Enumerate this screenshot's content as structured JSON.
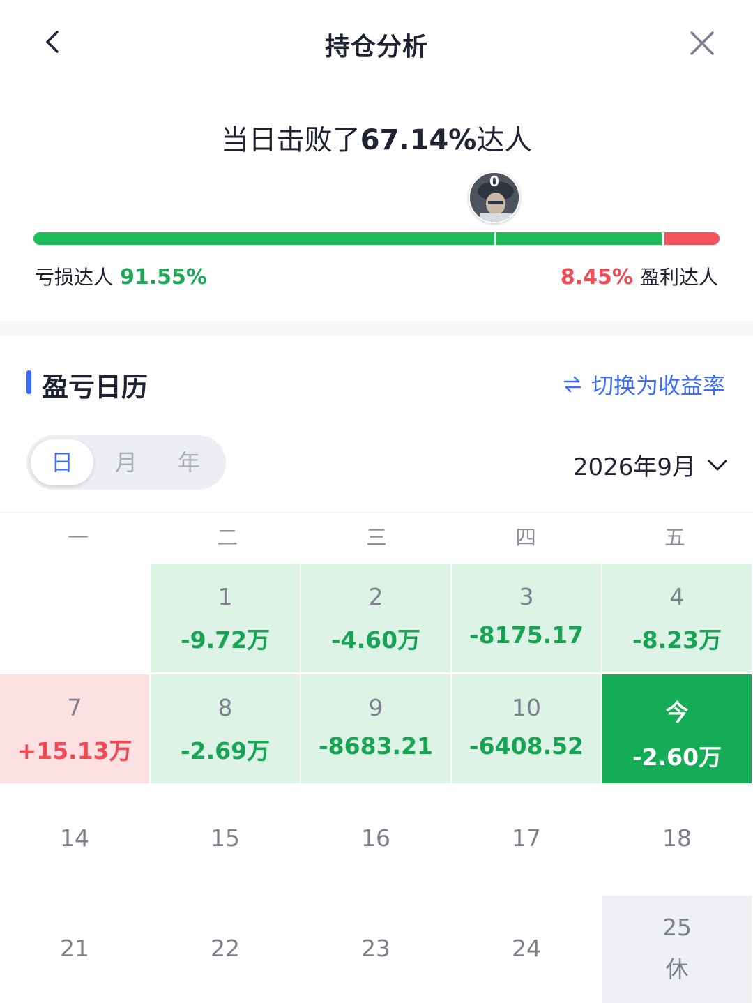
{
  "header": {
    "title": "持仓分析",
    "back_icon": "chevron-left-icon",
    "close_icon": "close-icon"
  },
  "beat": {
    "prefix": "当日击败了",
    "percent": "67.14%",
    "suffix": "达人",
    "avatar_badge": "0",
    "loss_label": "亏损达人",
    "loss_pct": "91.55%",
    "profit_pct": "8.45%",
    "profit_label": "盈利达人",
    "loss_fraction": 0.9155,
    "marker_fraction": 0.6714
  },
  "calendar": {
    "title": "盈亏日历",
    "switch_label": "切换为收益率",
    "switch_icon": "swap-arrows-icon",
    "tabs": [
      "日",
      "月",
      "年"
    ],
    "active_tab": "日",
    "month": "2026年9月",
    "month_icon": "chevron-down-icon",
    "weekdays": [
      "一",
      "二",
      "三",
      "四",
      "五"
    ],
    "rows": [
      [
        {
          "day": "",
          "value": "",
          "kind": "empty"
        },
        {
          "day": "1",
          "value": "-9.72万",
          "kind": "loss"
        },
        {
          "day": "2",
          "value": "-4.60万",
          "kind": "loss"
        },
        {
          "day": "3",
          "value": "-8175.17",
          "kind": "loss"
        },
        {
          "day": "4",
          "value": "-8.23万",
          "kind": "loss"
        }
      ],
      [
        {
          "day": "7",
          "value": "+15.13万",
          "kind": "gain"
        },
        {
          "day": "8",
          "value": "-2.69万",
          "kind": "loss"
        },
        {
          "day": "9",
          "value": "-8683.21",
          "kind": "loss"
        },
        {
          "day": "10",
          "value": "-6408.52",
          "kind": "loss"
        },
        {
          "day": "今",
          "value": "-2.60万",
          "kind": "today"
        }
      ],
      [
        {
          "day": "14",
          "value": "",
          "kind": "plain"
        },
        {
          "day": "15",
          "value": "",
          "kind": "plain"
        },
        {
          "day": "16",
          "value": "",
          "kind": "plain"
        },
        {
          "day": "17",
          "value": "",
          "kind": "plain"
        },
        {
          "day": "18",
          "value": "",
          "kind": "plain"
        }
      ],
      [
        {
          "day": "21",
          "value": "",
          "kind": "plain"
        },
        {
          "day": "22",
          "value": "",
          "kind": "plain"
        },
        {
          "day": "23",
          "value": "",
          "kind": "plain"
        },
        {
          "day": "24",
          "value": "",
          "kind": "plain"
        },
        {
          "day": "25",
          "value": "休",
          "kind": "rest"
        }
      ]
    ]
  },
  "colors": {
    "loss_green": "#17a555",
    "gain_red": "#f04a55",
    "accent_blue": "#3d6df5",
    "today_green": "#14ac55"
  }
}
